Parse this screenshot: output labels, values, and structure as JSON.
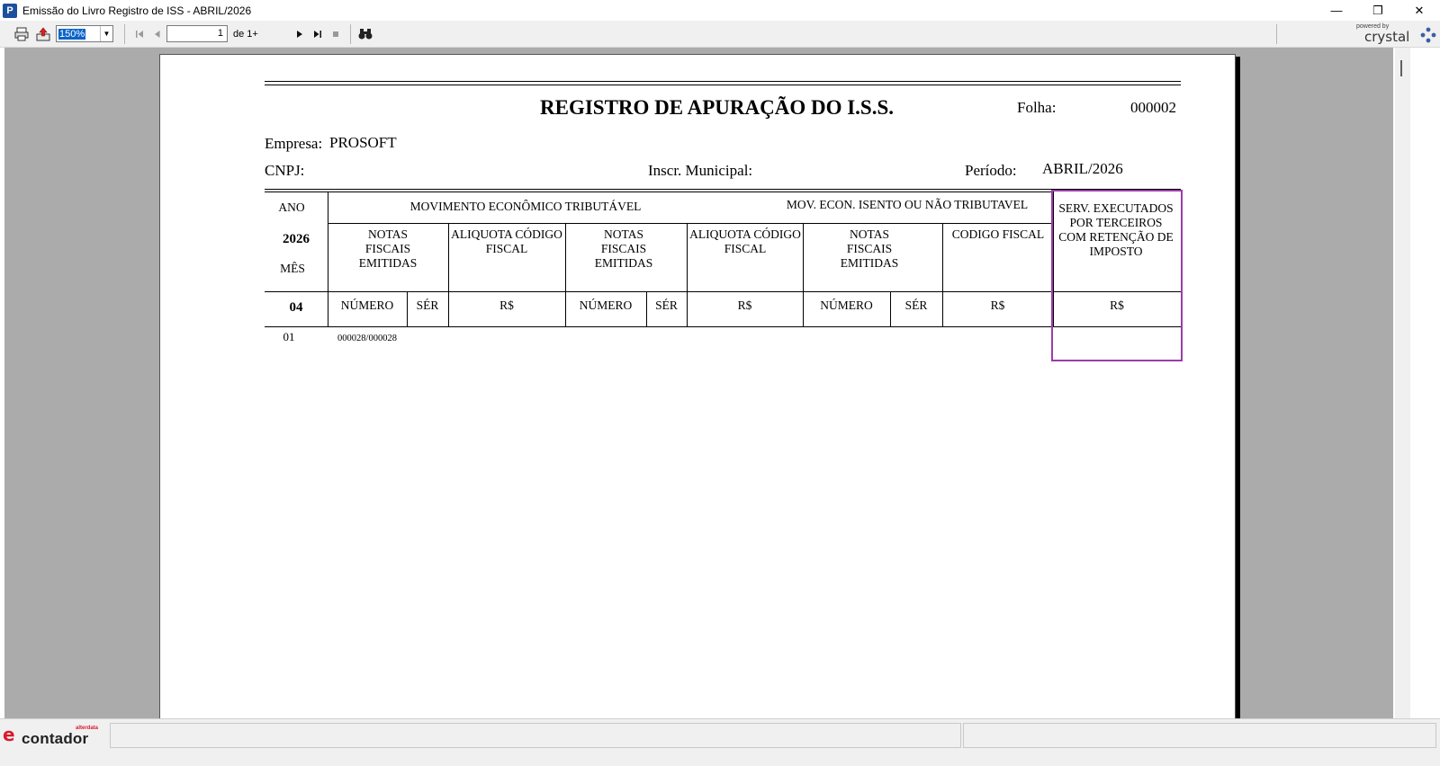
{
  "window": {
    "title": "Emissão do Livro Registro de ISS - ABRIL/2026",
    "icon_letter": "P",
    "minimize_glyph": "—",
    "restore_glyph": "❐",
    "close_glyph": "✕"
  },
  "toolbar": {
    "zoom_value": "150%",
    "page_current": "1",
    "page_of": "de 1+",
    "crystal_powered": "powered by",
    "crystal_word": "crystal"
  },
  "report": {
    "title": "REGISTRO DE APURAÇÃO DO I.S.S.",
    "folha_label": "Folha:",
    "folha_value": "000002",
    "empresa_label": "Empresa:",
    "empresa_value": "PROSOFT",
    "cnpj_label": "CNPJ:",
    "inscr_label": "Inscr. Municipal:",
    "periodo_label": "Período:",
    "periodo_value": "ABRIL/2026",
    "table": {
      "ano_label": "ANO",
      "ano_value": "2026",
      "mes_label": "MÊS",
      "mes_value": "04",
      "mov_tributavel": "MOVIMENTO ECONÔMICO TRIBUTÁVEL",
      "mov_isento": "MOV. ECON. ISENTO OU NÃO TRIBUTAVEL",
      "serv_terceiros": "SERV. EXECUTADOS POR TERCEIROS COM RETENÇÃO DE IMPOSTO",
      "notas_fiscais_1": "NOTAS FISCAIS EMITIDAS",
      "aliquota_1": "ALIQUOTA CÓDIGO  FISCAL",
      "notas_fiscais_2": "NOTAS FISCAIS EMITIDAS",
      "aliquota_2": "ALIQUOTA CÓDIGO  FISCAL",
      "notas_fiscais_3": "NOTAS FISCAIS EMITIDAS",
      "codigo_fiscal": "CODIGO  FISCAL",
      "numero_1": "NÚMERO",
      "ser_1": "SÉR",
      "rs_1": "R$",
      "numero_2": "NÚMERO",
      "ser_2": "SÉR",
      "rs_2": "R$",
      "numero_3": "NÚMERO",
      "ser_3": "SÉR",
      "rs_3": "R$",
      "rs_4": "R$",
      "rows": [
        {
          "dia": "01",
          "numero": "000028/000028"
        }
      ]
    }
  },
  "statusbar": {
    "logo_word": "contador",
    "logo_small": "alterdata"
  }
}
